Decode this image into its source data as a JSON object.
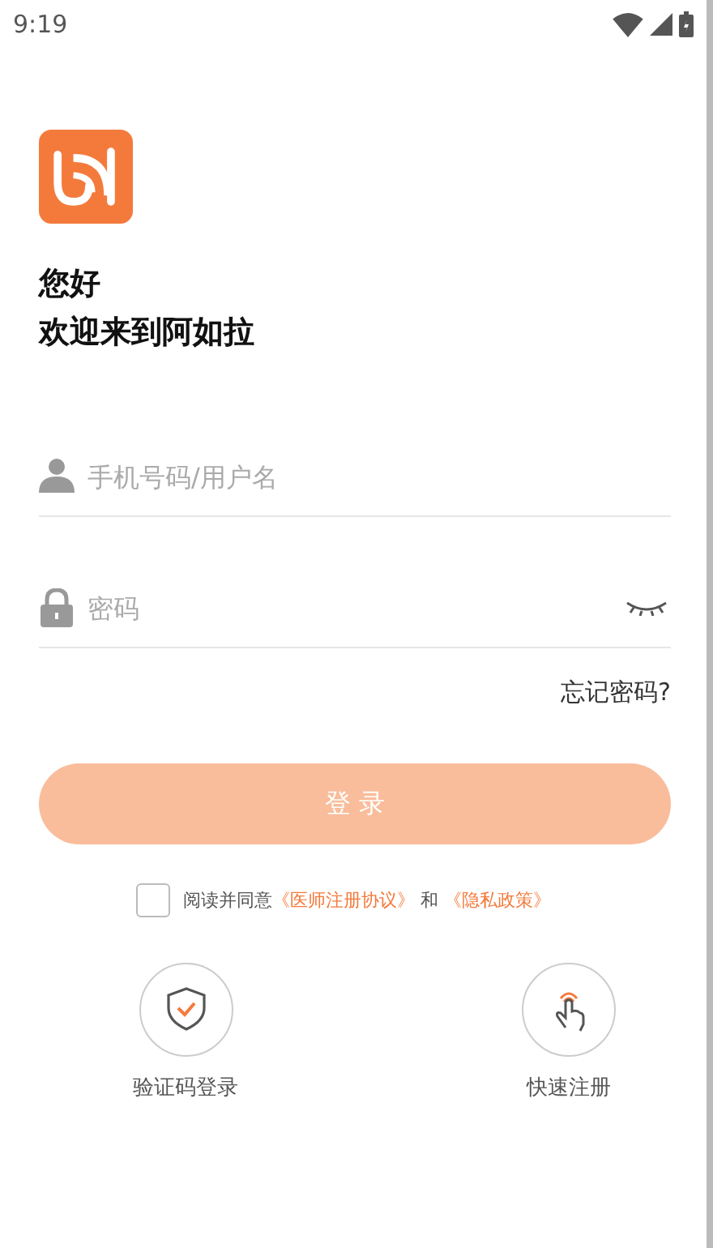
{
  "status_bar": {
    "time": "9:19"
  },
  "greeting": {
    "line_1": "您好",
    "line_2": "欢迎来到阿如拉"
  },
  "fields": [
    {
      "kind": "account",
      "placeholder": "手机号码/用户名"
    },
    {
      "kind": "password",
      "placeholder": "密码"
    }
  ],
  "forgot_password": "忘记密码?",
  "login_button": {
    "label": "登 录",
    "disabled": true
  },
  "agreement": {
    "checked": false,
    "text": "阅读并同意",
    "links": [
      "《医师注册协议》",
      "《隐私政策》"
    ],
    "joiner": "和"
  },
  "shortcuts": [
    {
      "kind": "sms",
      "label": "验证码登录"
    },
    {
      "kind": "register",
      "label": "快速注册"
    }
  ]
}
